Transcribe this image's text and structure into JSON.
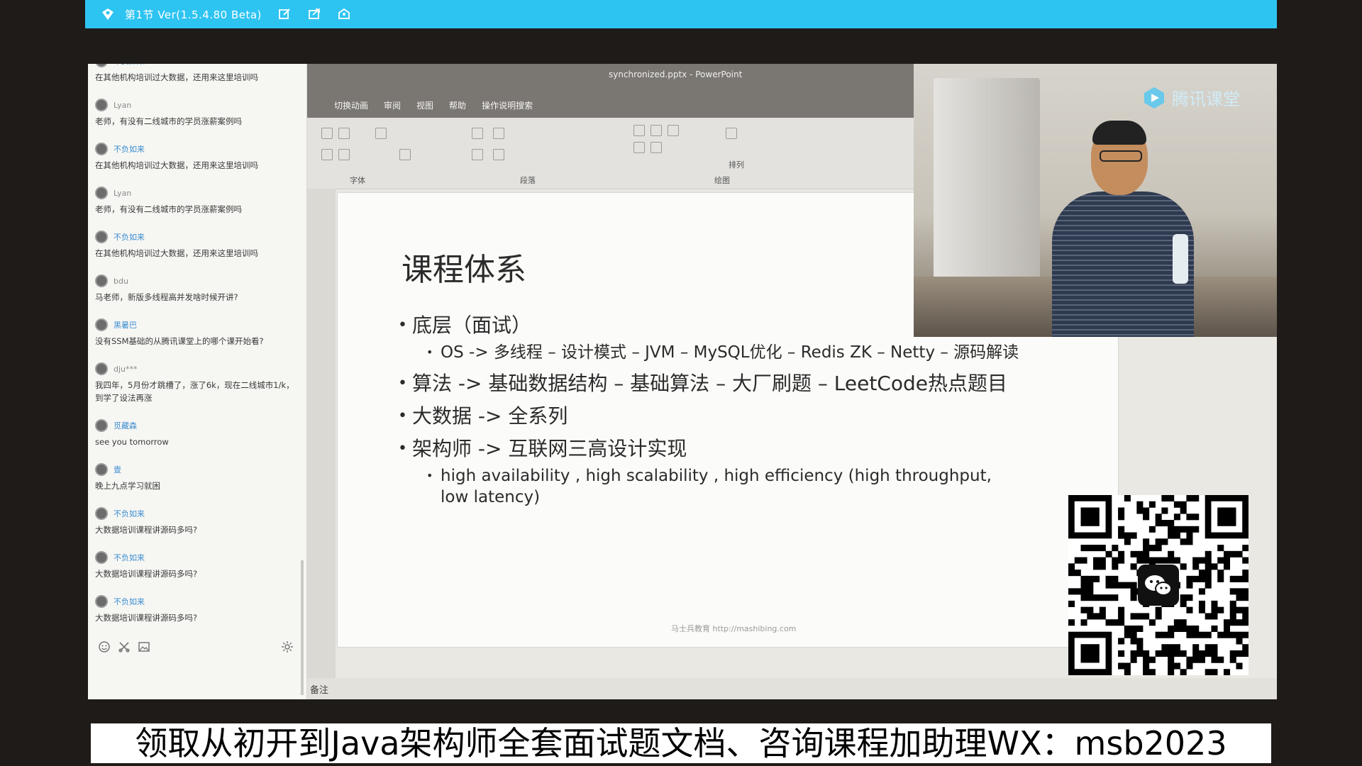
{
  "window": {
    "title": "第1节 Ver(1.5.4.80 Beta)"
  },
  "chat": {
    "messages": [
      {
        "name": "不负如来",
        "text": "在其他机构培训过大数据，还用来这里培训吗"
      },
      {
        "name": "Lyan",
        "text": "老师，有没有二线城市的学员涨薪案例吗"
      },
      {
        "name": "不负如来",
        "text": "在其他机构培训过大数据，还用来这里培训吗"
      },
      {
        "name": "Lyan",
        "text": "老师，有没有二线城市的学员涨薪案例吗"
      },
      {
        "name": "不负如来",
        "text": "在其他机构培训过大数据，还用来这里培训吗"
      },
      {
        "name": "bdu",
        "text": "马老师，新版多线程高并发啥时候开讲?"
      },
      {
        "name": "黑暑巴",
        "text": "没有SSM基础的从腾讯课堂上的哪个课开始看?"
      },
      {
        "name": "dju***",
        "text": "我四年，5月份才跳槽了，涨了6k，现在二线城市1/k，到学了设法再涨"
      },
      {
        "name": "觅藏森",
        "text": "see you tomorrow"
      },
      {
        "name": "壹",
        "text": "晚上九点学习就困"
      },
      {
        "name": "不负如来",
        "text": "大数据培训课程讲源码多吗?"
      },
      {
        "name": "不负如来",
        "text": "大数据培训课程讲源码多吗?"
      },
      {
        "name": "不负如来",
        "text": "大数据培训课程讲源码多吗?"
      }
    ]
  },
  "ppt": {
    "doc_title": "synchronized.pptx  -  PowerPoint",
    "tabs": [
      "切换动画",
      "审阅",
      "视图",
      "帮助",
      "操作说明搜索"
    ],
    "ribbon_groups": {
      "font": "字体",
      "paragraph": "段落",
      "drawing": "绘图",
      "arrange": "排列"
    },
    "status_notes": "备注",
    "slide": {
      "title": "课程体系",
      "bullets": [
        {
          "text": "底层（面试）",
          "sub": [
            "OS -> 多线程 – 设计模式 – JVM – MySQL优化 – Redis ZK – Netty – 源码解读"
          ]
        },
        {
          "text": "算法 -> 基础数据结构 – 基础算法 – 大厂刷题 – LeetCode热点题目",
          "sub": []
        },
        {
          "text": "大数据 -> 全系列",
          "sub": []
        },
        {
          "text": "架构师 -> 互联网三高设计实现",
          "sub": [
            "high availability , high scalability , high efficiency (high throughput, low latency)"
          ]
        }
      ],
      "footer": "马士兵教育 http://mashibing.com"
    }
  },
  "webcam": {
    "brand": "腾讯课堂"
  },
  "banner": {
    "text": "领取从初开到Java架构师全套面试题文档、咨询课程加助理WX：msb2023"
  }
}
